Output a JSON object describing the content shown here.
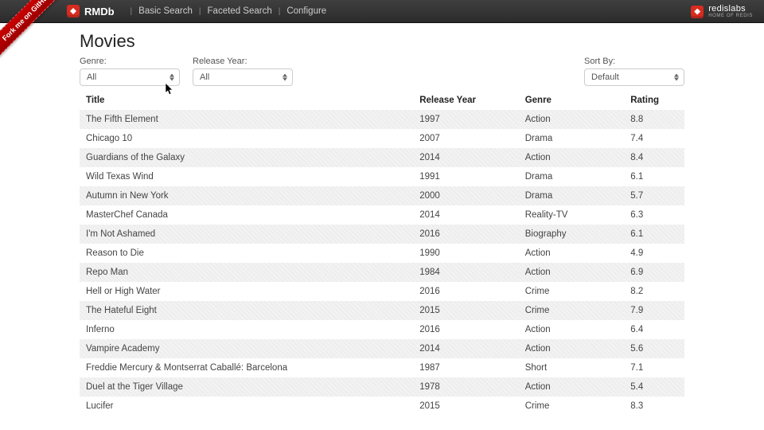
{
  "ribbon": {
    "text": "Fork me on GitHub"
  },
  "topbar": {
    "brand": "RMDb",
    "links": [
      {
        "label": "Basic Search"
      },
      {
        "label": "Faceted Search"
      },
      {
        "label": "Configure"
      }
    ],
    "right_brand_top": "redislabs",
    "right_brand_bottom": "HOME OF REDIS"
  },
  "page": {
    "title": "Movies"
  },
  "filters": {
    "genre": {
      "label": "Genre:",
      "value": "All"
    },
    "year": {
      "label": "Release Year:",
      "value": "All"
    },
    "sort": {
      "label": "Sort By:",
      "value": "Default"
    }
  },
  "table": {
    "columns": {
      "title": "Title",
      "year": "Release Year",
      "genre": "Genre",
      "rating": "Rating"
    },
    "rows": [
      {
        "title": "The Fifth Element",
        "year": "1997",
        "genre": "Action",
        "rating": "8.8"
      },
      {
        "title": "Chicago 10",
        "year": "2007",
        "genre": "Drama",
        "rating": "7.4"
      },
      {
        "title": "Guardians of the Galaxy",
        "year": "2014",
        "genre": "Action",
        "rating": "8.4"
      },
      {
        "title": "Wild Texas Wind",
        "year": "1991",
        "genre": "Drama",
        "rating": "6.1"
      },
      {
        "title": "Autumn in New York",
        "year": "2000",
        "genre": "Drama",
        "rating": "5.7"
      },
      {
        "title": "MasterChef Canada",
        "year": "2014",
        "genre": "Reality-TV",
        "rating": "6.3"
      },
      {
        "title": "I'm Not Ashamed",
        "year": "2016",
        "genre": "Biography",
        "rating": "6.1"
      },
      {
        "title": "Reason to Die",
        "year": "1990",
        "genre": "Action",
        "rating": "4.9"
      },
      {
        "title": "Repo Man",
        "year": "1984",
        "genre": "Action",
        "rating": "6.9"
      },
      {
        "title": "Hell or High Water",
        "year": "2016",
        "genre": "Crime",
        "rating": "8.2"
      },
      {
        "title": "The Hateful Eight",
        "year": "2015",
        "genre": "Crime",
        "rating": "7.9"
      },
      {
        "title": "Inferno",
        "year": "2016",
        "genre": "Action",
        "rating": "6.4"
      },
      {
        "title": "Vampire Academy",
        "year": "2014",
        "genre": "Action",
        "rating": "5.6"
      },
      {
        "title": "Freddie Mercury & Montserrat Caballé: Barcelona",
        "year": "1987",
        "genre": "Short",
        "rating": "7.1"
      },
      {
        "title": "Duel at the Tiger Village",
        "year": "1978",
        "genre": "Action",
        "rating": "5.4"
      },
      {
        "title": "Lucifer",
        "year": "2015",
        "genre": "Crime",
        "rating": "8.3"
      }
    ]
  }
}
